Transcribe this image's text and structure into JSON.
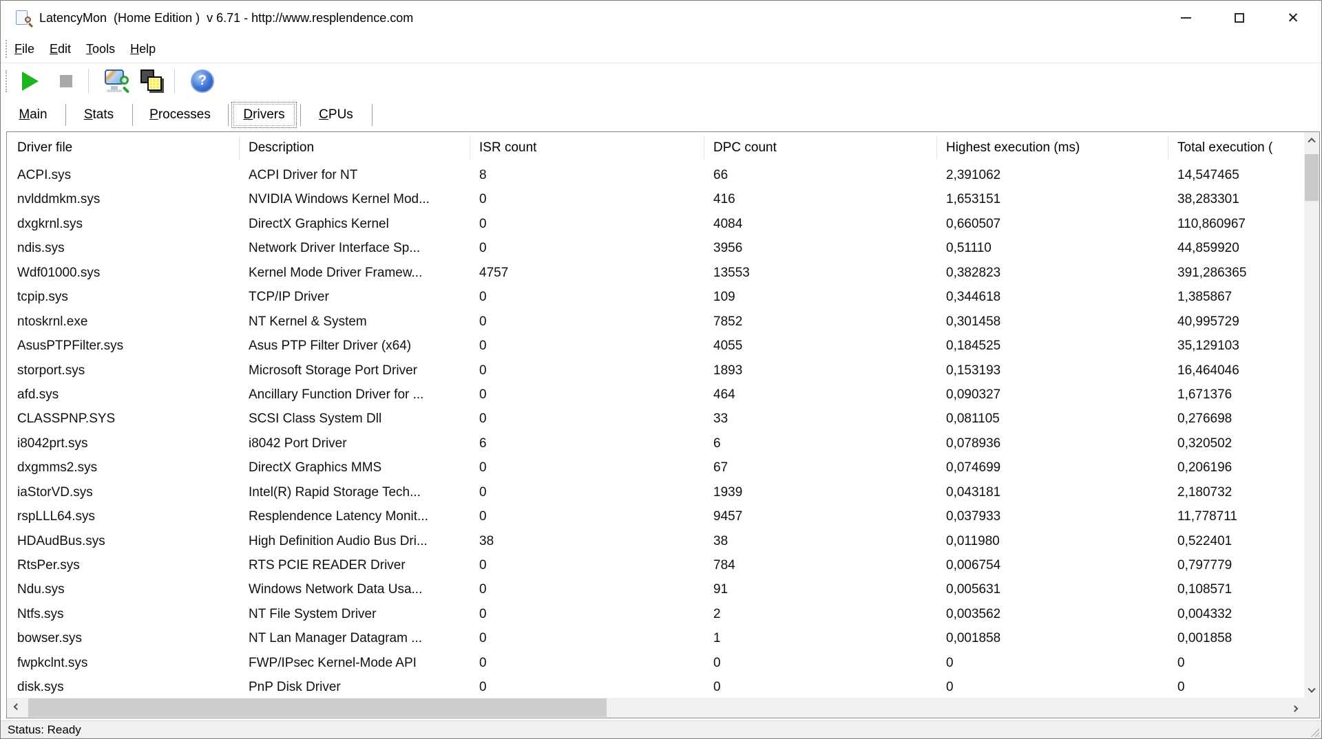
{
  "window": {
    "title": "LatencyMon  (Home Edition )  v 6.71 - http://www.resplendence.com",
    "controls": {
      "minimize": "minimize",
      "maximize": "maximize",
      "close": "✕"
    }
  },
  "menu": {
    "items": [
      "File",
      "Edit",
      "Tools",
      "Help"
    ]
  },
  "toolbar": {
    "buttons": [
      {
        "label": "start-monitoring",
        "icon": "play-icon"
      },
      {
        "label": "stop-monitoring",
        "icon": "stop-icon"
      },
      {
        "label": "edit-latencymon-options",
        "icon": "monitor-magnifier-icon"
      },
      {
        "label": "show-processes",
        "icon": "stacked-squares-icon"
      },
      {
        "label": "help",
        "icon": "question-mark-icon",
        "glyph": "?"
      }
    ]
  },
  "tabs": {
    "items": [
      "Main",
      "Stats",
      "Processes",
      "Drivers",
      "CPUs"
    ],
    "active": "Drivers"
  },
  "table": {
    "columns": [
      "Driver file",
      "Description",
      "ISR count",
      "DPC count",
      "Highest execution (ms)",
      "Total execution ("
    ],
    "rows": [
      [
        "ACPI.sys",
        "ACPI Driver for NT",
        "8",
        "66",
        "2,391062",
        "14,547465"
      ],
      [
        "nvlddmkm.sys",
        "NVIDIA Windows Kernel Mod...",
        "0",
        "416",
        "1,653151",
        "38,283301"
      ],
      [
        "dxgkrnl.sys",
        "DirectX Graphics Kernel",
        "0",
        "4084",
        "0,660507",
        "110,860967"
      ],
      [
        "ndis.sys",
        "Network Driver Interface Sp...",
        "0",
        "3956",
        "0,51110",
        "44,859920"
      ],
      [
        "Wdf01000.sys",
        "Kernel Mode Driver Framew...",
        "4757",
        "13553",
        "0,382823",
        "391,286365"
      ],
      [
        "tcpip.sys",
        "TCP/IP Driver",
        "0",
        "109",
        "0,344618",
        "1,385867"
      ],
      [
        "ntoskrnl.exe",
        "NT Kernel & System",
        "0",
        "7852",
        "0,301458",
        "40,995729"
      ],
      [
        "AsusPTPFilter.sys",
        "Asus PTP Filter Driver (x64)",
        "0",
        "4055",
        "0,184525",
        "35,129103"
      ],
      [
        "storport.sys",
        "Microsoft Storage Port Driver",
        "0",
        "1893",
        "0,153193",
        "16,464046"
      ],
      [
        "afd.sys",
        "Ancillary Function Driver for ...",
        "0",
        "464",
        "0,090327",
        "1,671376"
      ],
      [
        "CLASSPNP.SYS",
        "SCSI Class System Dll",
        "0",
        "33",
        "0,081105",
        "0,276698"
      ],
      [
        "i8042prt.sys",
        "i8042 Port Driver",
        "6",
        "6",
        "0,078936",
        "0,320502"
      ],
      [
        "dxgmms2.sys",
        "DirectX Graphics MMS",
        "0",
        "67",
        "0,074699",
        "0,206196"
      ],
      [
        "iaStorVD.sys",
        "Intel(R) Rapid Storage Tech...",
        "0",
        "1939",
        "0,043181",
        "2,180732"
      ],
      [
        "rspLLL64.sys",
        "Resplendence Latency Monit...",
        "0",
        "9457",
        "0,037933",
        "11,778711"
      ],
      [
        "HDAudBus.sys",
        "High Definition Audio Bus Dri...",
        "38",
        "38",
        "0,011980",
        "0,522401"
      ],
      [
        "RtsPer.sys",
        "RTS PCIE READER Driver",
        "0",
        "784",
        "0,006754",
        "0,797779"
      ],
      [
        "Ndu.sys",
        "Windows Network Data Usa...",
        "0",
        "91",
        "0,005631",
        "0,108571"
      ],
      [
        "Ntfs.sys",
        "NT File System Driver",
        "0",
        "2",
        "0,003562",
        "0,004332"
      ],
      [
        "bowser.sys",
        "NT Lan Manager Datagram ...",
        "0",
        "1",
        "0,001858",
        "0,001858"
      ],
      [
        "fwpkclnt.sys",
        "FWP/IPsec Kernel-Mode API",
        "0",
        "0",
        "0",
        "0"
      ],
      [
        "disk.sys",
        "PnP Disk Driver",
        "0",
        "0",
        "0",
        "0"
      ]
    ]
  },
  "statusbar": {
    "text": "Status: Ready"
  },
  "colors": {
    "play_green": "#1db41d",
    "icon_yellow": "#ffec43",
    "help_blue": "#3f74d4",
    "scroll_track": "#f1f1f1",
    "scroll_thumb": "#c9c9c9"
  }
}
